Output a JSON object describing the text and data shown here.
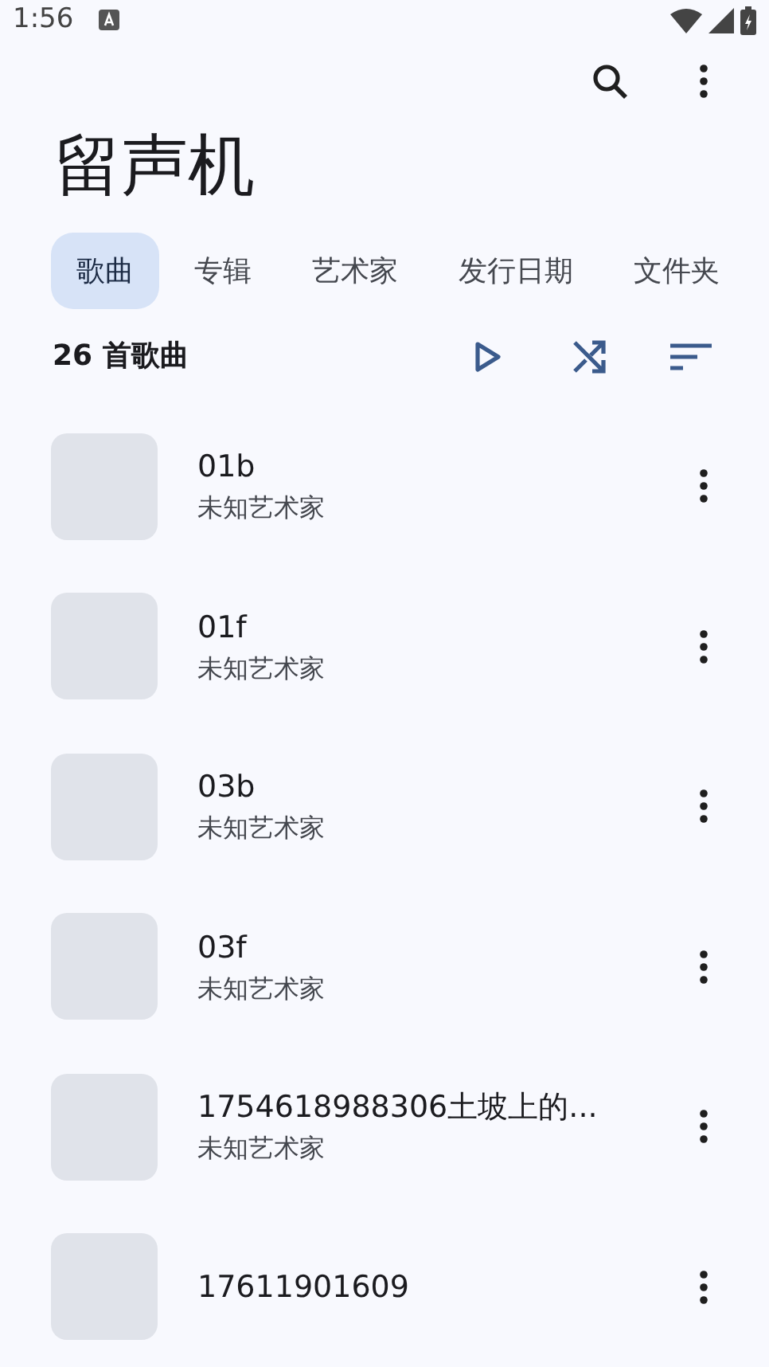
{
  "status_bar": {
    "time": "1:56"
  },
  "title": "留声机",
  "tabs": [
    {
      "label": "歌曲",
      "selected": true
    },
    {
      "label": "专辑",
      "selected": false
    },
    {
      "label": "艺术家",
      "selected": false
    },
    {
      "label": "发行日期",
      "selected": false
    },
    {
      "label": "文件夹",
      "selected": false
    }
  ],
  "song_count": "26 首歌曲",
  "songs": [
    {
      "title": "01b",
      "artist": "未知艺术家"
    },
    {
      "title": "01f",
      "artist": "未知艺术家"
    },
    {
      "title": "03b",
      "artist": "未知艺术家"
    },
    {
      "title": "03f",
      "artist": "未知艺术家"
    },
    {
      "title": "1754618988306土坡上的...",
      "artist": "未知艺术家"
    },
    {
      "title": "17611901609"
    }
  ]
}
